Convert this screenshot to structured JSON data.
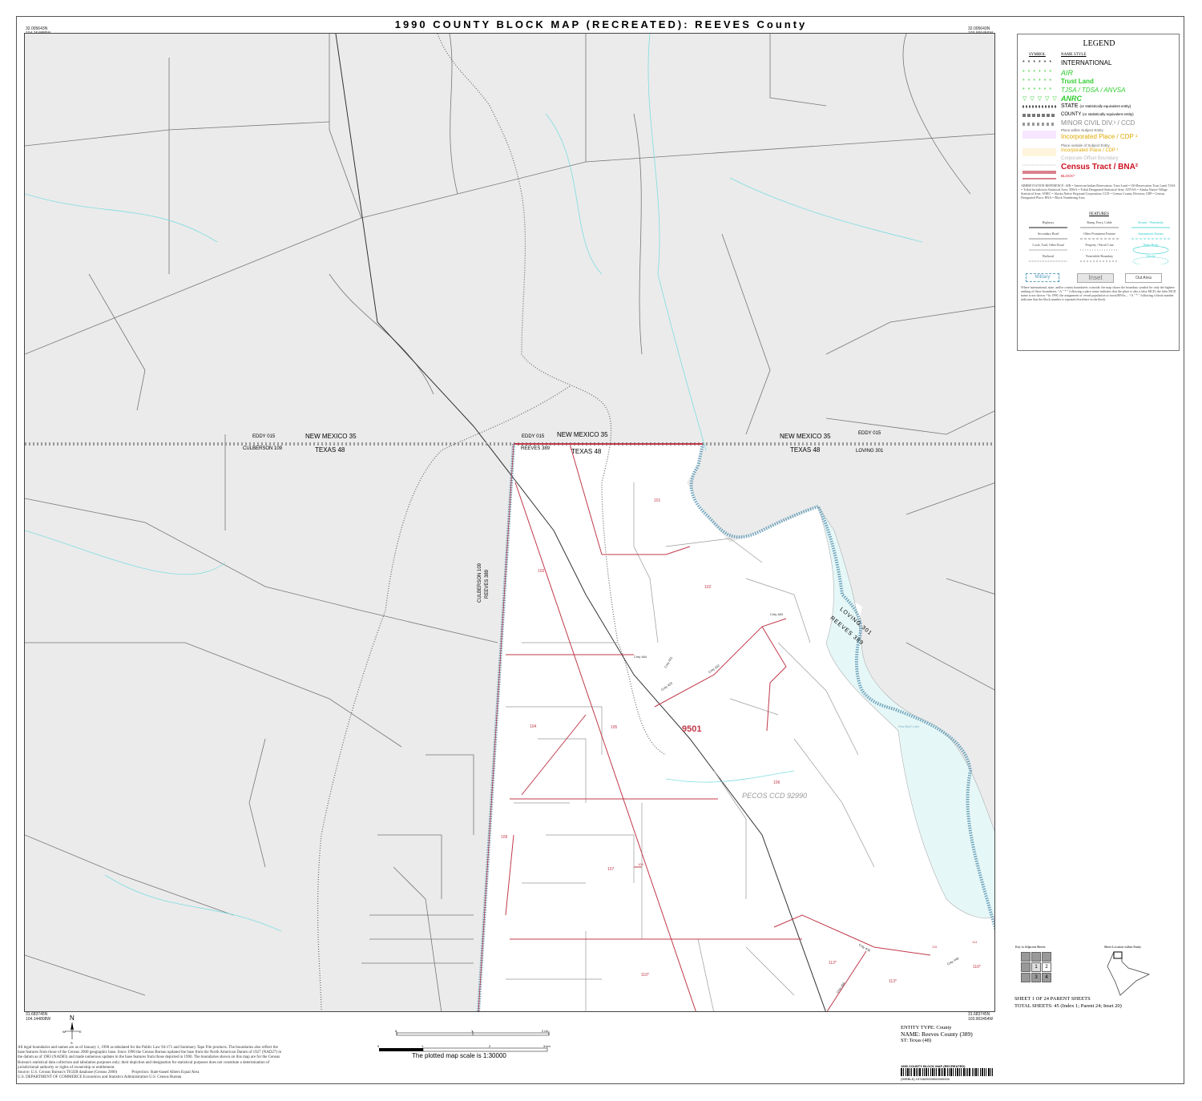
{
  "title": "1990 COUNTY BLOCK MAP (RECREATED): REEVES County",
  "corner_coords": {
    "top_left": [
      "32.005643N",
      "104.154889W"
    ],
    "top_right": [
      "32.005643N",
      "103.909456W"
    ],
    "bottom_left": [
      "31.683745N",
      "104.144808W"
    ],
    "bottom_right": [
      "31.683745N",
      "103.903454W"
    ]
  },
  "map_labels": {
    "nm_left": "NEW MEXICO 35",
    "tx_left": "TEXAS 48",
    "eddy_left": "EDDY 015",
    "culberson": "CULBERSON 109",
    "eddy_mid": "EDDY 015",
    "reeves_mid": "REEVES 389",
    "nm_mid": "NEW MEXICO 35",
    "tx_mid": "TEXAS 48",
    "nm_right": "NEW MEXICO 35",
    "tx_right": "TEXAS 48",
    "eddy_right": "EDDY 015",
    "loving": "LOVING 301",
    "county_vert_1": "CULBERSON 109",
    "county_vert_2": "REEVES 389",
    "loving_diag": "LOVING 301",
    "reeves_diag": "REEVES 389",
    "tract": "9501",
    "ccd": "PECOS CCD 92990",
    "blocks": [
      "101",
      "102",
      "103",
      "104",
      "105",
      "106",
      "107",
      "108",
      "109",
      "110",
      "111",
      "112",
      "113",
      "114",
      "115",
      "116"
    ],
    "blocks_star": [
      "110*",
      "112*",
      "113*",
      "116*"
    ],
    "roads": [
      "Cnty 433",
      "Cnty 432",
      "Cnty 431",
      "Cnty 430",
      "Cnty 450",
      "Cnty 448",
      "Cnty 483",
      "Cnty 484",
      "Red Bluff Lake"
    ]
  },
  "legend": {
    "heading": "LEGEND",
    "col_symbol": "SYMBOL",
    "col_name": "NAME STYLE",
    "items": [
      {
        "label": "INTERNATIONAL",
        "color": "#000000"
      },
      {
        "label": "AIR",
        "color": "#2ecc2e"
      },
      {
        "label": "Trust Land",
        "color": "#2ecc2e"
      },
      {
        "label": "TJSA / TDSA / ANVSA",
        "color": "#2ecc2e"
      },
      {
        "label": "ANRC",
        "color": "#2ecc2e"
      },
      {
        "label": "STATE",
        "sub": "(or statistically equivalent entity)",
        "color": "#000000"
      },
      {
        "label": "COUNTY",
        "sub": "(or statistically equivalent entity)",
        "color": "#000000"
      },
      {
        "label": "MINOR CIVIL DIV.¹ / CCD",
        "color": "#8a8a8a"
      },
      {
        "label": "Place within Subject Entity",
        "color": "#666666"
      },
      {
        "label": "Incorporated Place / CDP ¹",
        "color": "#e0a800"
      },
      {
        "label": "Place outside of Subject Entity",
        "color": "#666666"
      },
      {
        "label": "Incorporated Place / CDP ¹",
        "color": "#e0a800"
      },
      {
        "label": "Corporate Offset Boundary",
        "color": "#bbbbbb"
      },
      {
        "label": "Census Tract / BNA²",
        "color": "#cc1122"
      },
      {
        "label": "BLOCK³",
        "color": "#cc1122"
      }
    ],
    "abbrev": "ABBREVIATION REFERENCE: AIR = American Indian Reservation; Trust Land = Off-Reservation Trust Land; TJSA = Tribal Jurisdiction Statistical Area; TDSA = Tribal Designated Statistical Area; ANVSA = Alaska Native Village Statistical Area; ANRC = Alaska Native Regional Corporation; CCD = Census County Division; CDP = Census Designated Place; BNA = Block Numbering Area",
    "features_heading": "FEATURES",
    "features": [
      "Highway",
      "Ramp, Ferry, Cable",
      "Stream / Waterbody",
      "Secondary Road",
      "Other Prominent Feature",
      "Intermittent Stream",
      "Local, Trail, Other Road",
      "Property / Parcel Line",
      "Water Body",
      "Railroad",
      "Nonvisible Boundary",
      "Glacier"
    ],
    "boxes": [
      "Military",
      "Inset",
      "Out Area"
    ],
    "notes": "Where international, state, and/or county boundaries coincide, the map shows the boundary symbol for only the highest-ranking of these boundaries. ¹ A \" * \" following a place name indicates that the place is also a false MCD; the false MCD name is not shown. ² In 1990, the assignment of vessel population to tracts/BNAs ... ³ A \" * \" following a block number indicates that the block number is repeated elsewhere in the block."
  },
  "key": {
    "key_label": "Key to Adjacent Sheets",
    "cells": [
      "1",
      "2",
      "3",
      "4"
    ],
    "location_label": "Sheet Location within Entity"
  },
  "sheet": {
    "line1": "SHEET 1 OF 24 PARENT SHEETS",
    "line2": "TOTAL SHEETS: 45 (Index 1; Parent 24; Inset 20)"
  },
  "entity": {
    "type": "ENTITY TYPE: County",
    "name": "NAME: Reeves County (389)",
    "st": "ST: Texas (48)"
  },
  "scale": {
    "text": "The plotted map scale is 1:30000",
    "ticks_top": [
      "0",
      "",
      "1",
      "",
      "",
      "",
      "",
      "",
      "",
      "",
      "2 mi"
    ],
    "ticks_bottom": [
      "0",
      "1",
      "2",
      "3 km"
    ]
  },
  "barcode_title": "1990 COUNTY BLOCK MAP (RECREATED)",
  "barcode_id": "(99RBLK) 1974820000000000000",
  "disclaimer": "All legal boundaries and names are as of January 1, 1990 as tabulated for the Public Law 94-171 and Summary Tape File products. The boundaries also reflect the base features from those of the Census 2000 geographic base. Since 1990 the Census Bureau updated the base from the North American Datum of 1927 (NAD27) to the datum as of 1983 (NAD83) and made numerous updates to the base features from those depicted in 1990. The boundaries shown on this map are for the Census Bureau's statistical data collection and tabulation purposes only; their depiction and designation for statistical purposes does not constitute a determination of jurisdictional authority or rights of ownership or entitlement.",
  "source": "Source: U.S. Census Bureau's TIGER database (Census 2000)",
  "projection": "Projection: State-based Albers Equal Area",
  "dept": "U.S. DEPARTMENT OF COMMERCE Economics and Statistics Administration U.S. Census Bureau",
  "north": {
    "n": "N",
    "s": "S",
    "e": "E",
    "w": "W"
  },
  "colors": {
    "tract": "#c0394a",
    "water": "#7fdde0",
    "outside": "#ebebeb",
    "county_fill": "#7fb3c4"
  }
}
